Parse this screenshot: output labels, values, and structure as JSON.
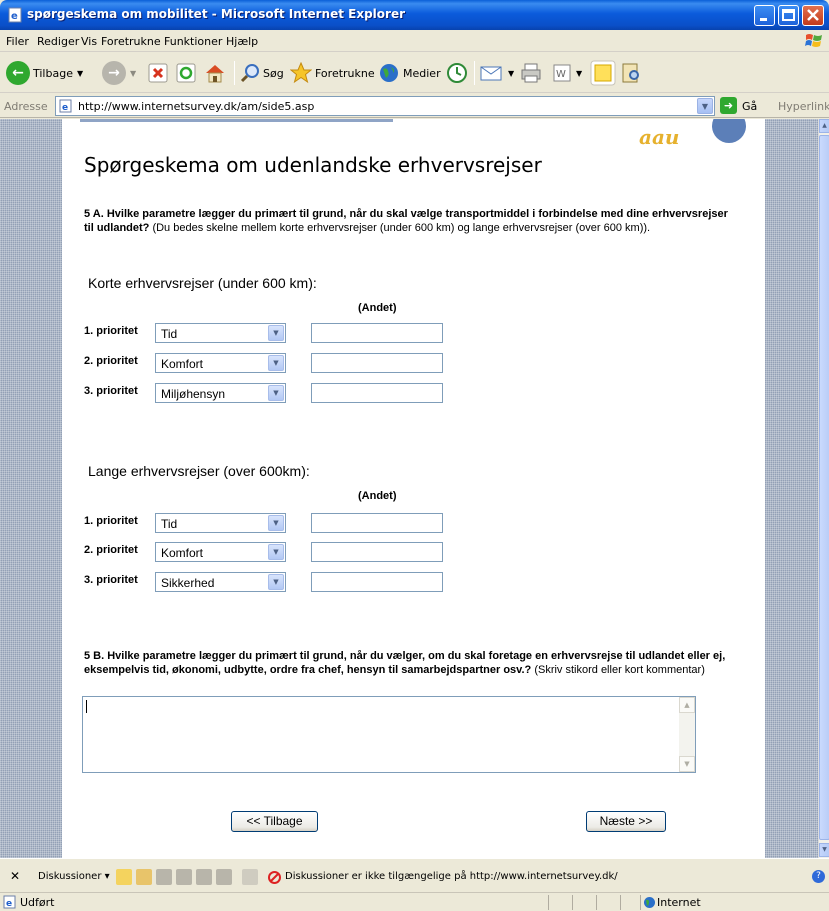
{
  "window": {
    "title": "spørgeskema om mobilitet - Microsoft Internet Explorer"
  },
  "menu": {
    "items": [
      "Filer",
      "Rediger",
      "Vis",
      "Foretrukne",
      "Funktioner",
      "Hjælp"
    ]
  },
  "toolbar": {
    "back_label": "Tilbage",
    "search_label": "Søg",
    "favorites_label": "Foretrukne",
    "media_label": "Medier"
  },
  "addressbar": {
    "label": "Adresse",
    "url": "http://www.internetsurvey.dk/am/side5.asp",
    "go_label": "Gå",
    "links_label": "Hyperlinks"
  },
  "page": {
    "logo_text": "aau",
    "title": "Spørgeskema om udenlandske erhvervsrejser",
    "question_5a_bold": "5 A. Hvilke parametre lægger du primært til grund, når du skal vælge transportmiddel i forbindelse med dine erhvervsrejser til udlandet?",
    "question_5a_rest": " (Du bedes skelne mellem korte erhvervsrejser (under 600 km) og lange erhvervsrejser (over 600 km)).",
    "short_trips": {
      "title": "Korte erhvervsrejser (under 600 km):",
      "other_header": "(Andet)",
      "rows": [
        {
          "label": "1. prioritet",
          "value": "Tid",
          "other": ""
        },
        {
          "label": "2. prioritet",
          "value": "Komfort",
          "other": ""
        },
        {
          "label": "3. prioritet",
          "value": "Miljøhensyn",
          "other": ""
        }
      ]
    },
    "long_trips": {
      "title": "Lange erhvervsrejser (over 600km):",
      "other_header": "(Andet)",
      "rows": [
        {
          "label": "1. prioritet",
          "value": "Tid",
          "other": ""
        },
        {
          "label": "2. prioritet",
          "value": "Komfort",
          "other": ""
        },
        {
          "label": "3. prioritet",
          "value": "Sikkerhed",
          "other": ""
        }
      ]
    },
    "question_5b_bold": "5 B. Hvilke parametre lægger du primært til grund, når du vælger, om du skal foretage en erhvervsrejse til udlandet eller ej, eksempelvis tid, økonomi, udbytte, ordre fra chef, hensyn til samarbejdspartner osv.?",
    "question_5b_rest": " (Skriv stikord eller kort kommentar)",
    "comment_value": "",
    "back_button": "<< Tilbage",
    "next_button": "Næste >>"
  },
  "discussions": {
    "label": "Diskussioner",
    "message": "Diskussioner er ikke tilgængelige på http://www.internetsurvey.dk/"
  },
  "status": {
    "text": "Udført",
    "zone": "Internet"
  }
}
